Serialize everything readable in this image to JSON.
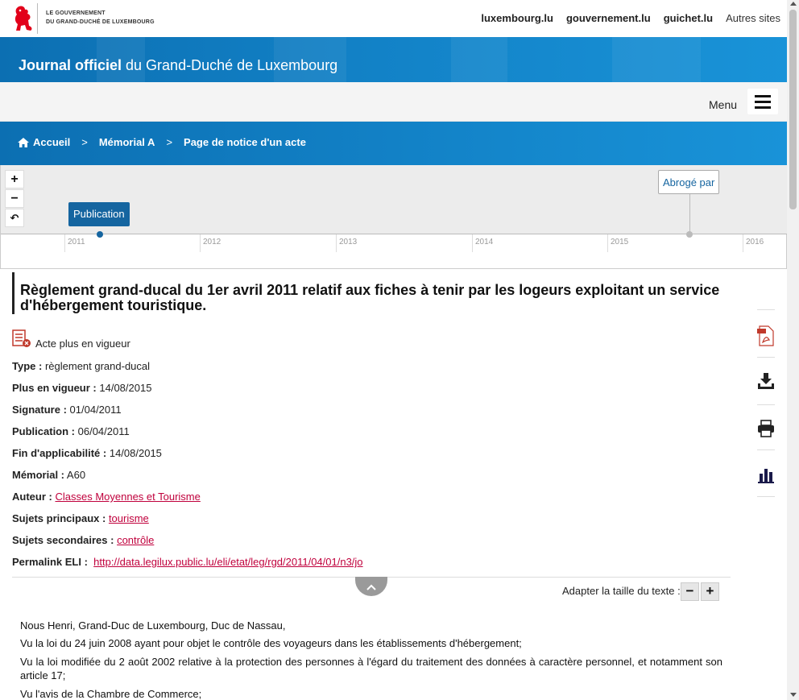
{
  "header": {
    "gov_line1": "Le Gouvernement",
    "gov_line2": "du Grand-Duché de Luxembourg",
    "links": [
      "luxembourg.lu",
      "gouvernement.lu",
      "guichet.lu"
    ],
    "other_sites": "Autres sites"
  },
  "banner": {
    "title_bold": "Journal officiel",
    "title_rest": " du Grand-Duché de Luxembourg"
  },
  "menu": {
    "label": "Menu"
  },
  "breadcrumb": {
    "home": "Accueil",
    "level1": "Mémorial A",
    "current": "Page de notice d'un acte",
    "sep": ">"
  },
  "timeline": {
    "zoom_in": "+",
    "zoom_out": "−",
    "reset": "↶",
    "publication_label": "Publication",
    "abroge_label": "Abrogé par",
    "years": [
      "2011",
      "2012",
      "2013",
      "2014",
      "2015",
      "2016"
    ]
  },
  "act": {
    "title": "Règlement grand-ducal du 1er avril 2011 relatif aux fiches à tenir par les logeurs exploitant un service d'hébergement touristique.",
    "status": "Acte plus en vigueur",
    "fields": [
      {
        "label": "Type :",
        "value": "règlement grand-ducal",
        "link": false
      },
      {
        "label": "Plus en vigueur :",
        "value": "14/08/2015",
        "link": false
      },
      {
        "label": "Signature :",
        "value": "01/04/2011",
        "link": false
      },
      {
        "label": "Publication :",
        "value": "06/04/2011",
        "link": false
      },
      {
        "label": "Fin d'applicabilité :",
        "value": "14/08/2015",
        "link": false
      },
      {
        "label": "Mémorial :",
        "value": "A60",
        "link": false
      },
      {
        "label": "Auteur :",
        "value": "Classes Moyennes et Tourisme",
        "link": true
      },
      {
        "label": "Sujets principaux :",
        "value": "tourisme",
        "link": true
      },
      {
        "label": "Sujets secondaires :",
        "value": "contrôle",
        "link": true
      },
      {
        "label": "Permalink ELI :",
        "value": "http://data.legilux.public.lu/eli/etat/leg/rgd/2011/04/01/n3/jo",
        "link": true
      }
    ]
  },
  "text_size": {
    "label": "Adapter la taille du texte :",
    "minus": "−",
    "plus": "+"
  },
  "body": {
    "p1": "Nous Henri, Grand-Duc de Luxembourg, Duc de Nassau,",
    "p2": "Vu la loi du 24 juin 2008 ayant pour objet le contrôle des voyageurs dans les établissements d'hébergement;",
    "p3": "Vu la loi modifiée du 2 août 2002 relative à la protection des personnes à l'égard du traitement des données à caractère personnel, et notamment son article 17;",
    "p4": "Vu l'avis de la Chambre de Commerce;"
  },
  "side_actions": [
    "pdf-icon",
    "download-icon",
    "print-icon",
    "stats-icon"
  ],
  "colors": {
    "brand_blue": "#1281c6",
    "link": "#c0003c",
    "timeline_blue": "#1565a0"
  }
}
